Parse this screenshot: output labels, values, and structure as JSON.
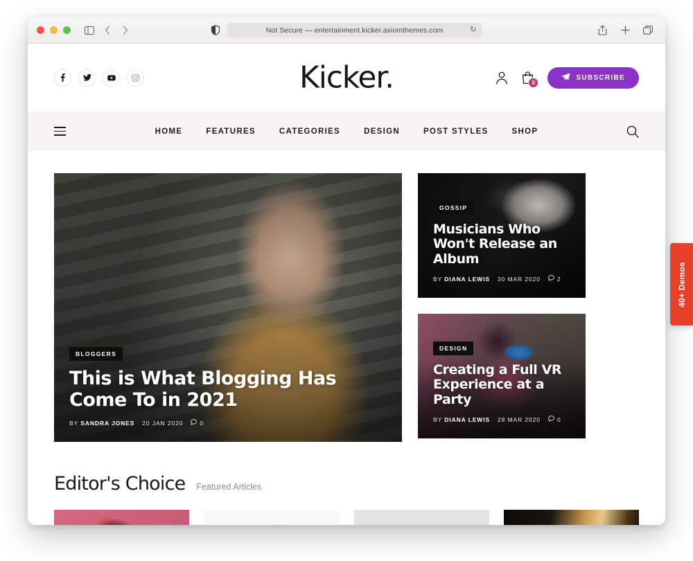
{
  "browser": {
    "url_text": "Not Secure — entertainment.kicker.axiomthemes.com",
    "reload_glyph": "↻",
    "back_glyph": "‹",
    "forward_glyph": "›",
    "traffic_lights": [
      "close",
      "minimize",
      "zoom"
    ],
    "icons": {
      "sidebar": "sidebar-icon",
      "shield": "shield-icon",
      "share": "share-icon",
      "new_tab": "plus-icon",
      "tabs_overview": "tabs-overview-icon"
    }
  },
  "header": {
    "brand": "Kicker.",
    "social": [
      {
        "name": "facebook",
        "glyph": "f"
      },
      {
        "name": "twitter",
        "glyph": "t"
      },
      {
        "name": "youtube",
        "glyph": "y"
      },
      {
        "name": "instagram",
        "glyph": "i"
      }
    ],
    "account_icon": "user-icon",
    "cart_icon": "cart-icon",
    "cart_count": "0",
    "subscribe_label": "SUBSCRIBE",
    "subscribe_icon": "paper-plane-icon",
    "subscribe_color": "#8a33c6",
    "cart_badge_color": "#d62b68"
  },
  "nav": {
    "menu_icon": "hamburger-icon",
    "search_icon": "search-icon",
    "items": [
      {
        "label": "HOME"
      },
      {
        "label": "FEATURES"
      },
      {
        "label": "CATEGORIES"
      },
      {
        "label": "DESIGN"
      },
      {
        "label": "POST STYLES"
      },
      {
        "label": "SHOP"
      }
    ]
  },
  "hero": {
    "main": {
      "category": "BLOGGERS",
      "title": "This is What Blogging Has Come To in 2021",
      "by_label": "BY",
      "author": "SANDRA JONES",
      "date": "20 JAN 2020",
      "comments": "0",
      "comment_icon": "comment-icon"
    },
    "side": [
      {
        "category": "GOSSIP",
        "title": "Musicians Who Won't Release an Album",
        "by_label": "BY",
        "author": "DIANA LEWIS",
        "date": "30 MAR 2020",
        "comments": "2",
        "comment_icon": "comment-icon"
      },
      {
        "category": "DESIGN",
        "title": "Creating a Full VR Experience at a Party",
        "by_label": "BY",
        "author": "DIANA LEWIS",
        "date": "28 MAR 2020",
        "comments": "0",
        "comment_icon": "comment-icon"
      }
    ]
  },
  "editors_choice": {
    "title": "Editor's Choice",
    "subtitle": "Featured Articles",
    "thumbs": [
      {
        "name": "thumb-woman-pink-bandana"
      },
      {
        "name": "thumb-woman-laughing"
      },
      {
        "name": "thumb-dancer-grey"
      },
      {
        "name": "thumb-silhouette-sunset"
      }
    ]
  },
  "demos_tab": {
    "label": "40+ Demos",
    "color": "#e7402a"
  }
}
